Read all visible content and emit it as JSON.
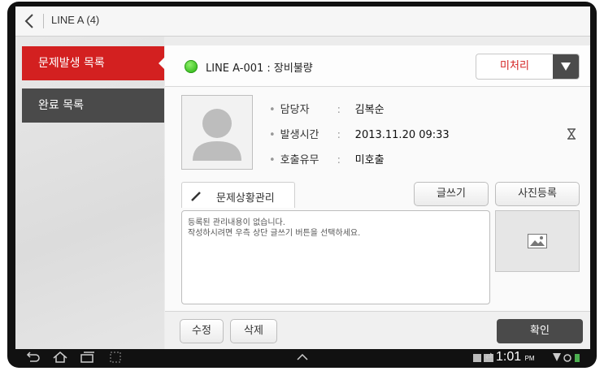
{
  "header": {
    "title": "LINE A (4)"
  },
  "sidebar": {
    "items": [
      {
        "label": "문제발생 목록",
        "active": true
      },
      {
        "label": "완료 목록",
        "active": false
      }
    ]
  },
  "issue": {
    "title": "LINE A-001 : 장비불량",
    "status_color": "#3cbf23",
    "status_value": "미처리",
    "details": [
      {
        "label": "담당자",
        "value": "김복순"
      },
      {
        "label": "발생시간",
        "value": "2013.11.20 09:33"
      },
      {
        "label": "호출유무",
        "value": "미호출"
      }
    ]
  },
  "tab": {
    "label": "문제상황관리"
  },
  "buttons": {
    "write": "글쓰기",
    "photo_register": "사진등록",
    "edit": "수정",
    "delete": "삭제",
    "confirm": "확인"
  },
  "memo": {
    "line1": "등록된 관리내용이 없습니다.",
    "line2": "작성하시려면 우측 상단 글쓰기 버튼을 선택하세요."
  },
  "statusbar": {
    "time": "1:01",
    "ampm": "PM"
  },
  "colors": {
    "accent_red": "#d32020",
    "dark_gray": "#4a4a4a"
  }
}
